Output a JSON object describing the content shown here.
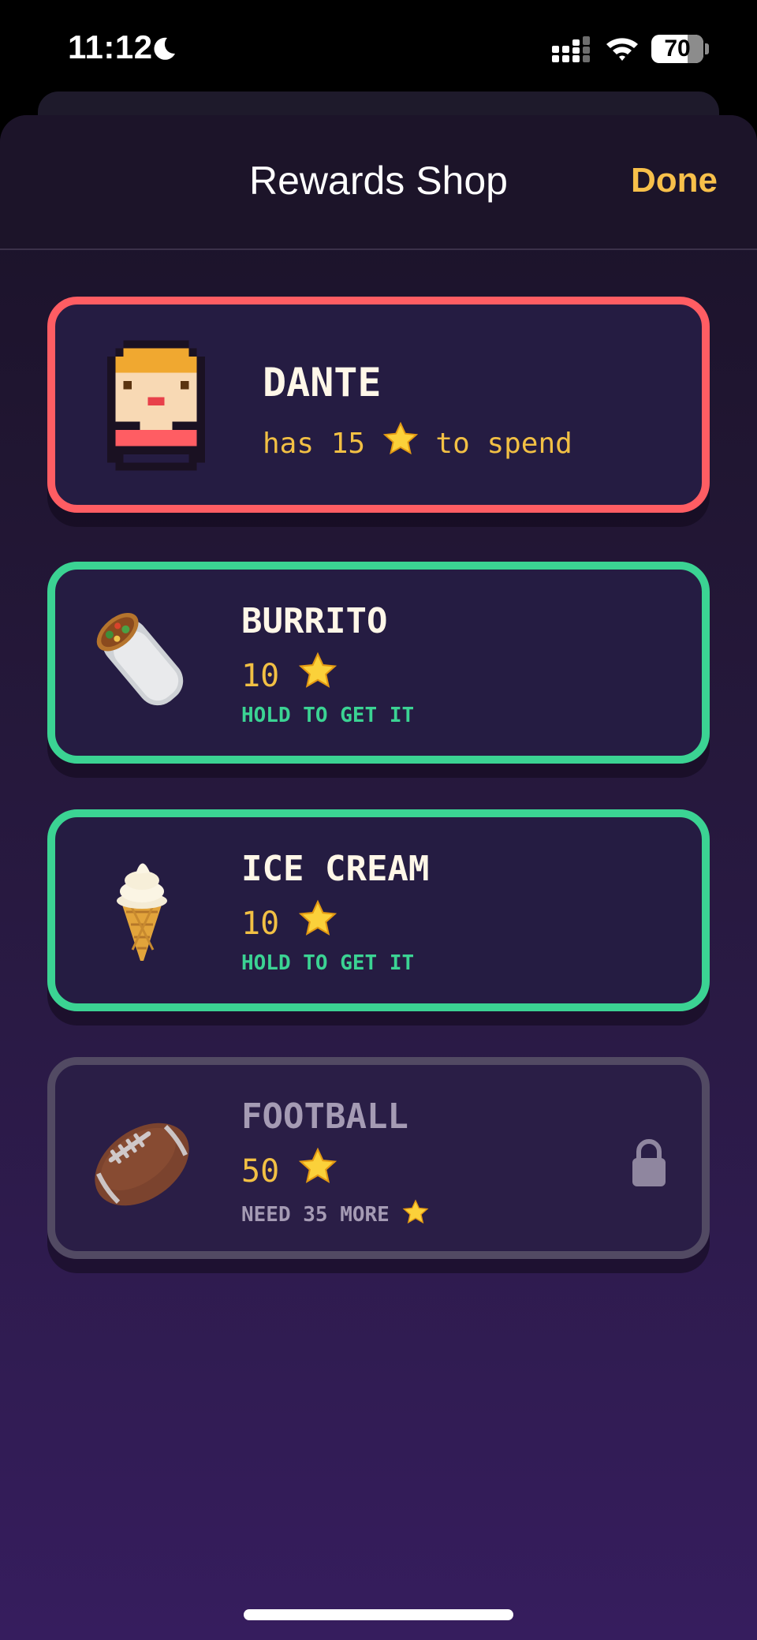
{
  "status_bar": {
    "time": "11:12",
    "battery": "70",
    "icons": [
      "moon-icon",
      "signal-icon",
      "wifi-icon",
      "battery-icon"
    ]
  },
  "nav": {
    "title": "Rewards Shop",
    "done_label": "Done"
  },
  "profile": {
    "name": "DANTE",
    "sub_prefix": "has 15",
    "sub_suffix": "to spend",
    "border_color": "#ff5d63"
  },
  "items": [
    {
      "name": "BURRITO",
      "cost": "10",
      "action": "HOLD TO GET IT",
      "icon": "burrito-icon",
      "available": true
    },
    {
      "name": "ICE CREAM",
      "cost": "10",
      "action": "HOLD TO GET IT",
      "icon": "ice-cream-icon",
      "available": true
    },
    {
      "name": "FOOTBALL",
      "cost": "50",
      "action": "NEED 35 MORE",
      "icon": "football-icon",
      "available": false
    }
  ],
  "colors": {
    "accent": "#f7c04a",
    "available": "#3bd393",
    "locked": "#524a63",
    "profile": "#ff5d63"
  }
}
